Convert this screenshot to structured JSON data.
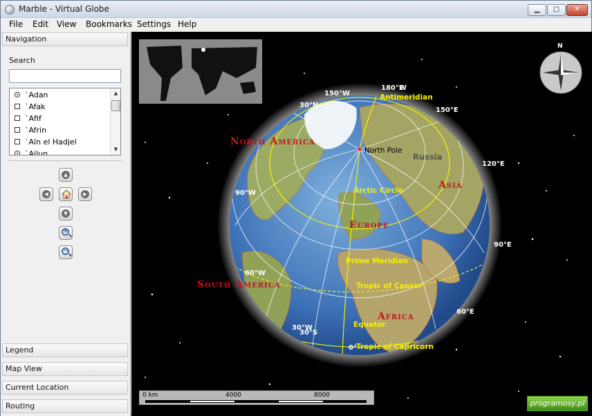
{
  "window": {
    "title": "Marble - Virtual Globe",
    "min_glyph": "▁",
    "max_glyph": "▢",
    "close_glyph": "✕"
  },
  "menu": [
    "File",
    "Edit",
    "View",
    "Bookmarks",
    "Settings",
    "Help"
  ],
  "sidebar": {
    "navigation_header": "Navigation",
    "search_label": "Search",
    "search_value": "",
    "list_items": [
      {
        "label": "`Adan",
        "icon": "city-icon"
      },
      {
        "label": "`Afak",
        "icon": "town-icon"
      },
      {
        "label": "`Afif",
        "icon": "town-icon"
      },
      {
        "label": "`Afrin",
        "icon": "town-icon"
      },
      {
        "label": "`Aïn el Hadjel",
        "icon": "town-icon"
      },
      {
        "label": "`Ajlun",
        "icon": "city-icon"
      }
    ],
    "bottom_panels": [
      "Legend",
      "Map View",
      "Current Location",
      "Routing"
    ]
  },
  "map": {
    "grid_labels": [
      "150°W",
      "180°E",
      "150°E",
      "30°N",
      "120°E",
      "90°W",
      "90°E",
      "60°W",
      "60°E",
      "30°W",
      "30°S",
      "0°"
    ],
    "grid_label_extra": "W",
    "line_labels": [
      "Antimeridian",
      "Arctic Circle",
      "Prime Meridian",
      "Tropic of Cancer",
      "Equator",
      "Tropic of Capricorn"
    ],
    "place_labels": [
      "North Pole",
      "Russia"
    ],
    "continent_labels": [
      "North America",
      "Asia",
      "Europe",
      "South America",
      "Africa"
    ],
    "compass_letter": "N",
    "scale": {
      "start": "0 km",
      "mid": "4000",
      "end": "8000"
    }
  },
  "watermark": "programosy.pl"
}
